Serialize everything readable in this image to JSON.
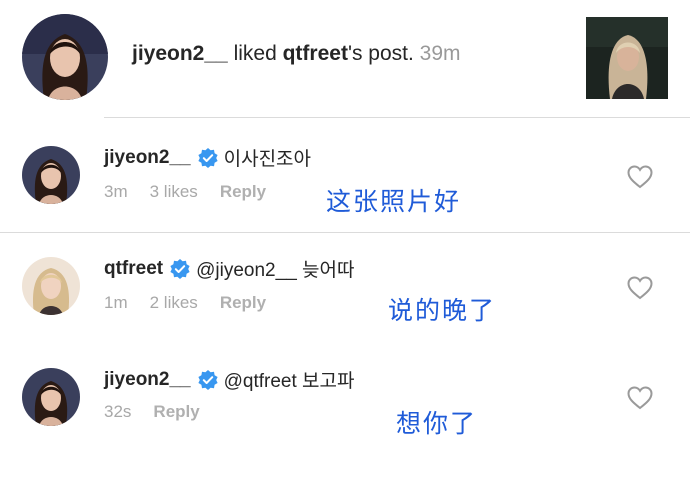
{
  "notification": {
    "actor": "jiyeon2__",
    "action": " liked ",
    "target": "qtfreet",
    "suffix": "'s post.",
    "time": "39m"
  },
  "comments": [
    {
      "username": "jiyeon2__",
      "text": "이사진조아",
      "time": "3m",
      "likes": "3 likes",
      "reply": "Reply",
      "overlay": "这张照片好"
    },
    {
      "username": "qtfreet",
      "text": "@jiyeon2__ 늦어따",
      "time": "1m",
      "likes": "2 likes",
      "reply": "Reply",
      "overlay": "说的晚了"
    },
    {
      "username": "jiyeon2__",
      "text": "@qtfreet 보고파",
      "time": "32s",
      "reply": "Reply",
      "overlay": "想你了"
    }
  ],
  "colors": {
    "verified": "#3897f0",
    "overlay_text": "#1f5bd8",
    "meta_text": "#a8a8a8",
    "divider": "#dbdbdb"
  },
  "icons": [
    "verified-badge-icon",
    "heart-outline-icon"
  ]
}
